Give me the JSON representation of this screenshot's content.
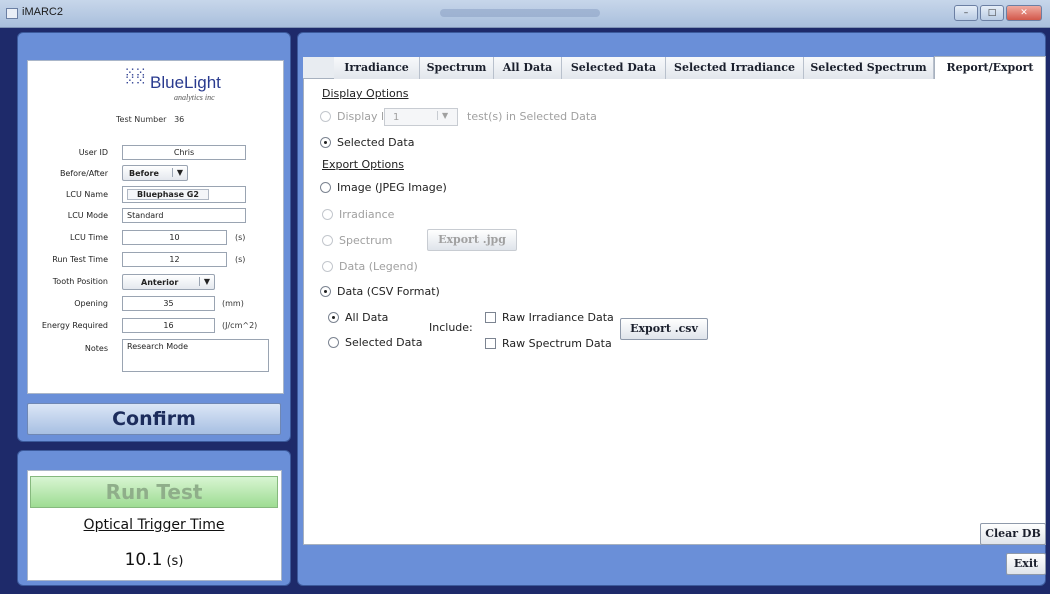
{
  "window": {
    "title": "iMARC2",
    "controls": [
      "–",
      "□",
      "✕"
    ]
  },
  "logo": {
    "brand": "BlueLight",
    "sub": "analytics inc"
  },
  "test": {
    "label": "Test Number",
    "number": "36"
  },
  "form": {
    "user_id": {
      "label": "User ID",
      "value": "Chris"
    },
    "before_after": {
      "label": "Before/After",
      "value": "Before"
    },
    "lcu_name": {
      "label": "LCU Name",
      "value": "Bluephase G2"
    },
    "lcu_mode": {
      "label": "LCU Mode",
      "value": "Standard"
    },
    "lcu_time": {
      "label": "LCU Time",
      "value": "10",
      "unit": "(s)"
    },
    "run_test_time": {
      "label": "Run Test Time",
      "value": "12",
      "unit": "(s)"
    },
    "tooth_position": {
      "label": "Tooth Position",
      "value": "Anterior"
    },
    "opening": {
      "label": "Opening",
      "value": "35",
      "unit": "(mm)"
    },
    "energy_required": {
      "label": "Energy Required",
      "value": "16",
      "unit": "(J/cm^2)"
    },
    "notes": {
      "label": "Notes",
      "value": "Research Mode"
    }
  },
  "confirm_label": "Confirm",
  "run_test_label": "Run Test",
  "trigger": {
    "label": "Optical Trigger Time",
    "value": "10.1",
    "unit": "(s)"
  },
  "tabs": [
    "Irradiance",
    "Spectrum",
    "All Data",
    "Selected Data",
    "Selected Irradiance",
    "Selected Spectrum",
    "Report/Export"
  ],
  "active_tab": "Report/Export",
  "display_options": {
    "heading": "Display Options",
    "display_last_label": "Display last",
    "display_last_value": "1",
    "display_last_tail": "test(s) in Selected Data",
    "selected_data_label": "Selected Data"
  },
  "export_options": {
    "heading": "Export Options",
    "image_label": "Image (JPEG Image)",
    "irradiance_label": "Irradiance",
    "spectrum_label": "Spectrum",
    "export_jpg_label": "Export .jpg",
    "data_legend_label": "Data (Legend)",
    "csv_label": "Data (CSV Format)",
    "all_data_label": "All Data",
    "selected_data_label": "Selected Data",
    "include_label": "Include:",
    "raw_irradiance_label": "Raw Irradiance Data",
    "raw_spectrum_label": "Raw Spectrum Data",
    "export_csv_label": "Export .csv"
  },
  "clear_db_label": "Clear DB",
  "exit_label": "Exit"
}
